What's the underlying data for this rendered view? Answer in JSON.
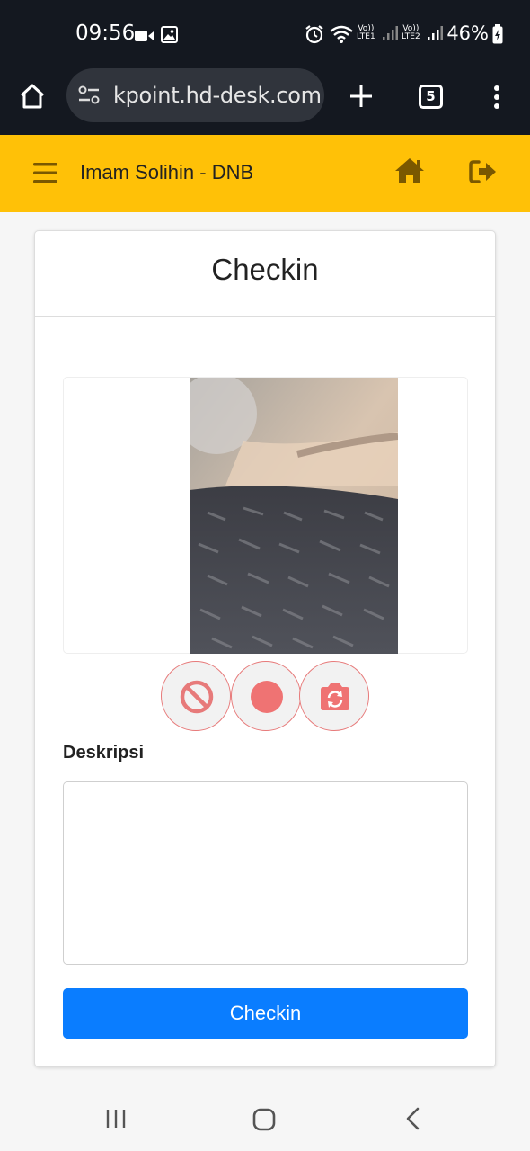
{
  "status_bar": {
    "time": "09:56",
    "battery": "46%",
    "sim1_top": "Vo))",
    "sim1_bottom": "LTE1",
    "sim2_top": "Vo))",
    "sim2_bottom": "LTE2",
    "icons": [
      "video-icon",
      "image-icon",
      "alarm-icon",
      "wifi-icon",
      "signal-icon",
      "battery-icon"
    ]
  },
  "browser": {
    "url": "kpoint.hd-desk.com",
    "tab_count": "5",
    "icons": [
      "home-icon",
      "site-settings-icon",
      "new-tab-icon",
      "tabs-icon",
      "menu-icon"
    ]
  },
  "header": {
    "user_name": "Imam Solihin - DNB",
    "icons": [
      "hamburger-icon",
      "home-icon",
      "logout-icon"
    ],
    "bg_color": "#ffc107",
    "icon_color": "#7a5800"
  },
  "card": {
    "title": "Checkin",
    "camera_buttons": [
      "cancel-icon",
      "record-icon",
      "switch-camera-icon"
    ],
    "description_label": "Deskripsi",
    "description_value": "",
    "submit_label": "Checkin",
    "button_color": "#0a7dff",
    "camera_button_color": "#e77a7a"
  },
  "system_nav": {
    "icons": [
      "recent-apps-icon",
      "home-icon",
      "back-icon"
    ]
  }
}
